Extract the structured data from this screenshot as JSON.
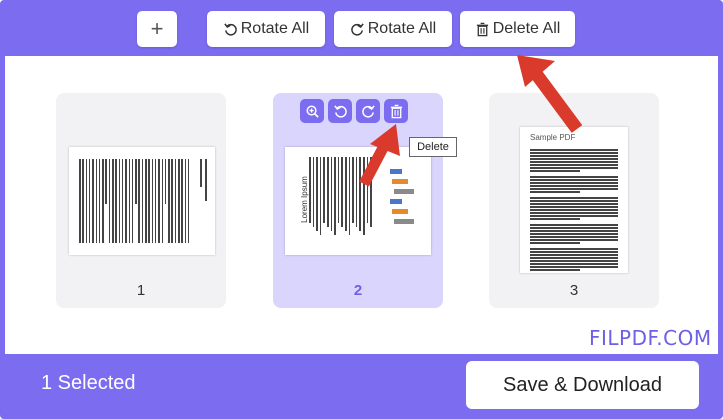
{
  "toolbar": {
    "add_label": "+",
    "rotate_left_label": "Rotate All",
    "rotate_right_label": "Rotate All",
    "delete_all_label": "Delete All"
  },
  "pages": [
    {
      "number": "1",
      "selected": false
    },
    {
      "number": "2",
      "selected": true
    },
    {
      "number": "3",
      "selected": false
    }
  ],
  "page3_thumb": {
    "title": "Sample PDF"
  },
  "page2_thumb": {
    "title": "Lorem Ipsum"
  },
  "page_tools": [
    "zoom-in-icon",
    "rotate-left-icon",
    "rotate-right-icon",
    "trash-icon"
  ],
  "tooltip": "Delete",
  "watermark": "FILPDF.COM",
  "footer": {
    "selected_text": "1 Selected",
    "save_label": "Save & Download"
  },
  "colors": {
    "accent": "#7b6cf0",
    "selected_card": "#d9d5fc",
    "arrow": "#d93a2b"
  }
}
